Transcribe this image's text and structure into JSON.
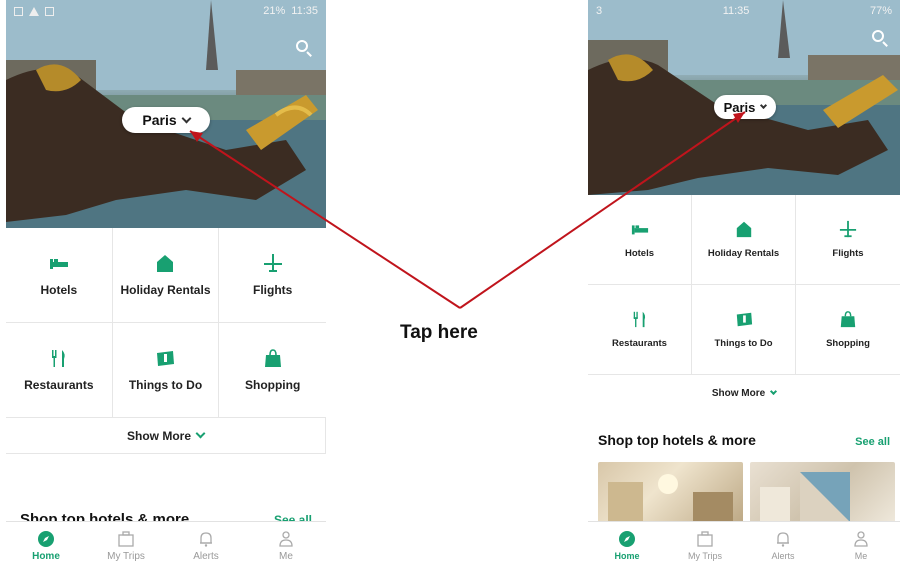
{
  "android": {
    "status": {
      "signal": "21%",
      "time": "11:35"
    },
    "city": {
      "name": "Paris"
    },
    "categories": [
      {
        "label": "Hotels",
        "icon": "bed-icon"
      },
      {
        "label": "Holiday Rentals",
        "icon": "house-icon"
      },
      {
        "label": "Flights",
        "icon": "plane-icon"
      },
      {
        "label": "Restaurants",
        "icon": "fork-knife-icon"
      },
      {
        "label": "Things to Do",
        "icon": "ticket-icon"
      },
      {
        "label": "Shopping",
        "icon": "shopping-bag-icon"
      }
    ],
    "show_more": "Show More",
    "shop": {
      "title": "Shop top hotels & more",
      "see_all": "See all"
    },
    "tabs": [
      {
        "label": "Home",
        "icon": "compass-icon",
        "active": true
      },
      {
        "label": "My Trips",
        "icon": "suitcase-icon",
        "active": false
      },
      {
        "label": "Alerts",
        "icon": "bell-icon",
        "active": false
      },
      {
        "label": "Me",
        "icon": "person-icon",
        "active": false
      }
    ]
  },
  "ios": {
    "status": {
      "carrier": "3",
      "time": "11:35",
      "battery": "77%"
    },
    "city": {
      "name": "Paris"
    },
    "categories": [
      {
        "label": "Hotels",
        "icon": "bed-icon"
      },
      {
        "label": "Holiday Rentals",
        "icon": "house-icon"
      },
      {
        "label": "Flights",
        "icon": "plane-icon"
      },
      {
        "label": "Restaurants",
        "icon": "fork-knife-icon"
      },
      {
        "label": "Things to Do",
        "icon": "ticket-icon"
      },
      {
        "label": "Shopping",
        "icon": "shopping-bag-icon"
      }
    ],
    "show_more": "Show More",
    "shop": {
      "title": "Shop top hotels & more",
      "see_all": "See all"
    },
    "tabs": [
      {
        "label": "Home",
        "icon": "compass-icon",
        "active": true
      },
      {
        "label": "My Trips",
        "icon": "suitcase-icon",
        "active": false
      },
      {
        "label": "Alerts",
        "icon": "bell-icon",
        "active": false
      },
      {
        "label": "Me",
        "icon": "person-icon",
        "active": false
      }
    ]
  },
  "annotation": {
    "text": "Tap here",
    "color": "#c0141c"
  },
  "colors": {
    "accent": "#18a071"
  }
}
